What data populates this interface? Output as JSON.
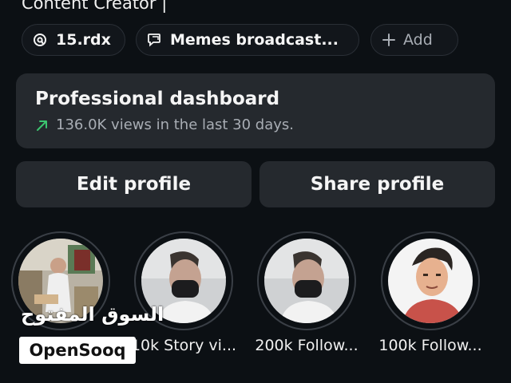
{
  "profile": {
    "bio_line": "Content Creator |"
  },
  "chips": {
    "threads": {
      "label": "15.rdx",
      "icon": "threads-icon"
    },
    "broadcast": {
      "label": "Memes broadcast...",
      "icon": "broadcast-channel-icon"
    },
    "add": {
      "label": "Add",
      "icon": "plus-icon"
    }
  },
  "dashboard": {
    "title": "Professional dashboard",
    "subtitle": "136.0K views in the last 30 days.",
    "trend_icon": "trend-up-arrow-icon",
    "trend_color": "#3bc46f"
  },
  "actions": {
    "edit_label": "Edit profile",
    "share_label": "Share profile"
  },
  "highlights": [
    {
      "label": ""
    },
    {
      "label": "10k Story vi..."
    },
    {
      "label": "200k Follow..."
    },
    {
      "label": "100k Follow..."
    }
  ],
  "watermark": {
    "arabic": "السوق المفتوح",
    "latin": "OpenSooq"
  },
  "colors": {
    "background": "#0c1014",
    "card": "#25292e",
    "muted_text": "#a8adb4"
  }
}
